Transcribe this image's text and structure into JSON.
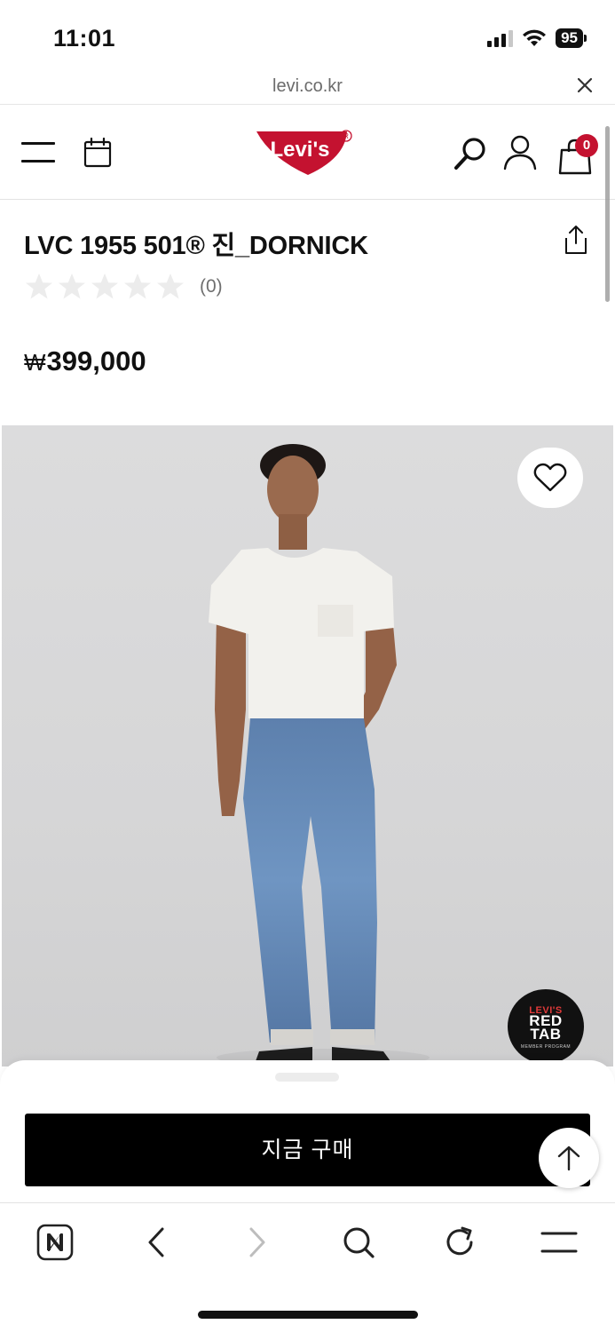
{
  "status_bar": {
    "time": "11:01",
    "battery": "95"
  },
  "url_bar": {
    "url": "levi.co.kr"
  },
  "header": {
    "logo_text": "Levi's",
    "bag_count": "0",
    "brand_color": "#c41230"
  },
  "product": {
    "title": "LVC 1955 501® 진_DORNICK",
    "rating_count": "(0)",
    "stars_total": 5,
    "stars_filled": 0,
    "price": "399,000",
    "currency": "₩"
  },
  "badge": {
    "line1": "LEVI'S",
    "line2": "RED",
    "line3": "TAB",
    "line4": "MEMBER PROGRAM"
  },
  "bottom_sheet": {
    "buy_label": "지금 구매"
  },
  "icons": {
    "header": [
      "menu-icon",
      "calendar-icon",
      "search-icon",
      "account-icon",
      "shopping-bag-icon"
    ],
    "product": [
      "share-icon",
      "heart-icon"
    ],
    "toolbar": [
      "naver-home-icon",
      "back-icon",
      "forward-icon",
      "search-icon",
      "refresh-icon",
      "menu-icon"
    ]
  }
}
